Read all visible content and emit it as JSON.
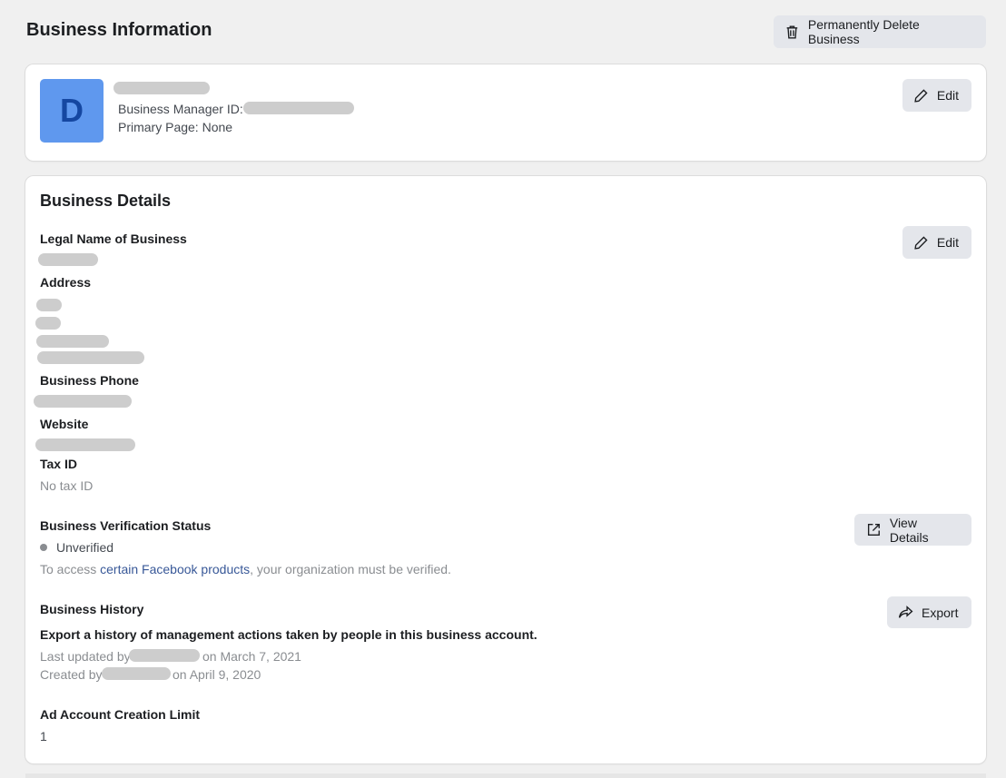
{
  "page": {
    "title": "Business Information",
    "delete_button": "Permanently Delete Business",
    "delete_icon": "trash-icon"
  },
  "profile": {
    "avatar_letter": "D",
    "avatar_color": "#5f98ee",
    "business_manager_id_label": "Business Manager ID:",
    "primary_page": "Primary Page: None",
    "edit_button": "Edit",
    "edit_icon": "pencil-icon"
  },
  "details": {
    "title": "Business Details",
    "edit_button": "Edit",
    "legal_name_label": "Legal Name of Business",
    "address_label": "Address",
    "phone_label": "Business Phone",
    "website_label": "Website",
    "tax_id_label": "Tax ID",
    "tax_id_value": "No tax ID",
    "verification": {
      "label": "Business Verification Status",
      "status": "Unverified",
      "note_prefix": "To access ",
      "note_link": "certain Facebook products",
      "note_suffix": ", your organization must be verified.",
      "view_button": "View Details",
      "view_icon": "external-link-icon"
    },
    "history": {
      "label": "Business History",
      "description": "Export a history of management actions taken by people in this business account.",
      "last_updated_prefix": "Last updated by",
      "last_updated_suffix": "on March 7, 2021",
      "created_prefix": "Created by",
      "created_suffix": "on April 9, 2020",
      "export_button": "Export",
      "export_icon": "share-arrow-icon"
    },
    "ad_limit": {
      "label": "Ad Account Creation Limit",
      "value": "1"
    }
  }
}
